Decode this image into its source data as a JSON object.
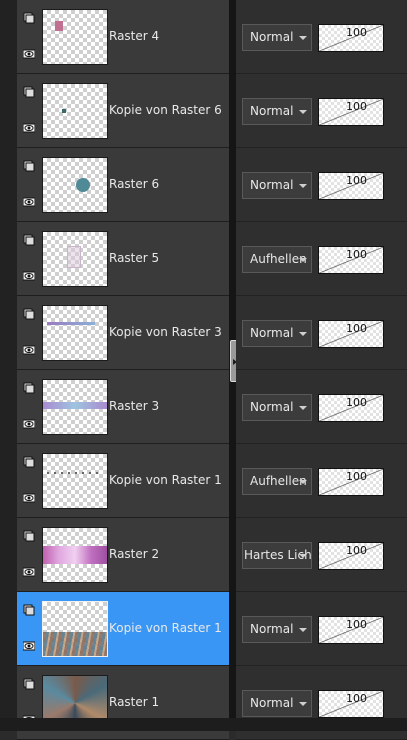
{
  "layers": [
    {
      "name": "Raster 4",
      "blend_mode": "Normal",
      "opacity": "100",
      "selected": false
    },
    {
      "name": "Kopie von Raster 6",
      "blend_mode": "Normal",
      "opacity": "100",
      "selected": false
    },
    {
      "name": "Raster 6",
      "blend_mode": "Normal",
      "opacity": "100",
      "selected": false
    },
    {
      "name": "Raster 5",
      "blend_mode": "Aufhellen",
      "opacity": "100",
      "selected": false
    },
    {
      "name": "Kopie von Raster 3",
      "blend_mode": "Normal",
      "opacity": "100",
      "selected": false
    },
    {
      "name": "Raster 3",
      "blend_mode": "Normal",
      "opacity": "100",
      "selected": false
    },
    {
      "name": "Kopie von Raster 1",
      "blend_mode": "Aufhellen",
      "opacity": "100",
      "selected": false
    },
    {
      "name": "Raster 2",
      "blend_mode": "Hartes Licht",
      "opacity": "100",
      "selected": false
    },
    {
      "name": "Kopie von Raster 1",
      "blend_mode": "Normal",
      "opacity": "100",
      "selected": true
    },
    {
      "name": "Raster 1",
      "blend_mode": "Normal",
      "opacity": "100",
      "selected": false
    }
  ],
  "colors": {
    "selection": "#3a96f5",
    "panel": "#3a3a3a"
  }
}
